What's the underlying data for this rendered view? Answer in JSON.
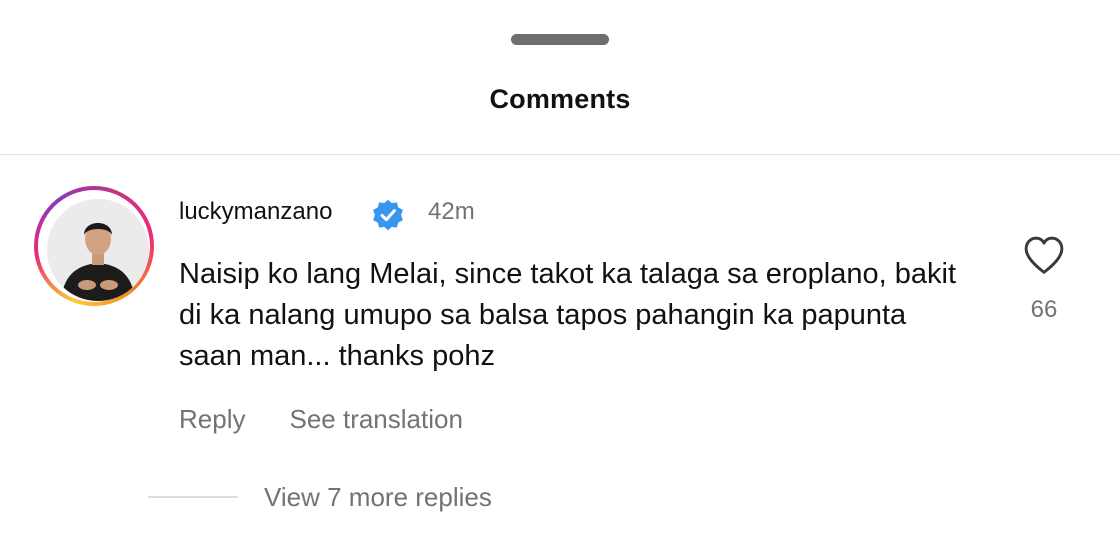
{
  "sheet": {
    "title": "Comments"
  },
  "comment": {
    "username": "luckymanzano",
    "verified": true,
    "timestamp": "42m",
    "text": "Naisip ko lang Melai, since takot ka talaga sa eroplano, bakit di ka nalang umupo sa balsa tapos pahangin ka papunta saan man... thanks pohz",
    "like_count": "66",
    "reply_label": "Reply",
    "translate_label": "See translation",
    "view_replies_label": "View 7 more replies"
  },
  "icons": {
    "verified": "verified-badge-icon",
    "like": "heart-outline-icon"
  },
  "colors": {
    "verified_blue": "#3797f0",
    "secondary_text": "#737373",
    "primary_text": "#111111"
  }
}
